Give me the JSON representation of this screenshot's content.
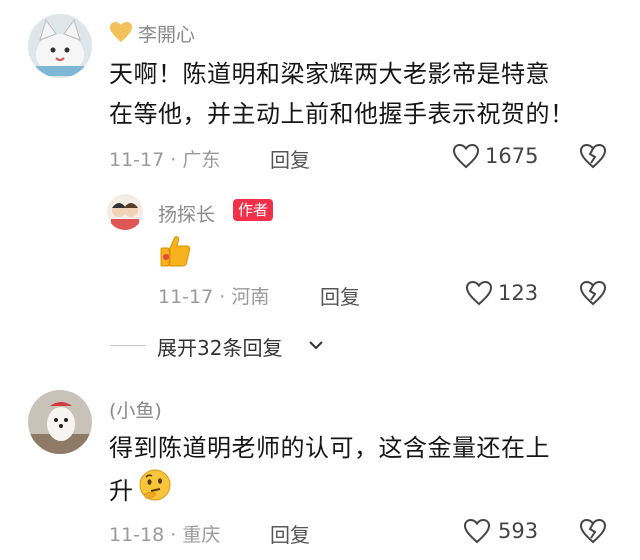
{
  "comments": [
    {
      "username": "李開心",
      "content_line1": "天啊！陈道明和梁家辉两大老影帝是特意",
      "content_line2": "在等他，并主动上前和他握手表示祝贺的！",
      "date_location": "11-17 · 广东",
      "reply_label": "回复",
      "like_count": "1675"
    },
    {
      "username": "(小鱼)",
      "content_line1": "得到陈道明老师的认可，这含金量还在上",
      "content_line2": "升",
      "date_location": "11-18 · 重庆",
      "reply_label": "回复",
      "like_count": "593"
    }
  ],
  "reply": {
    "username": "扬探长",
    "author_badge": "作者",
    "emoji": "👍",
    "date_location": "11-17 · 河南",
    "reply_label": "回复",
    "like_count": "123"
  },
  "expand": {
    "label": "展开32条回复"
  },
  "icons": {
    "like": "heart-outline-icon",
    "dislike": "broken-heart-icon",
    "badge": "heart-badge-icon",
    "expand": "chevron-down-icon"
  },
  "colors": {
    "author_badge": "#f3304a",
    "thumb": "#f7b21e",
    "username_badge": "#f2c15a"
  }
}
